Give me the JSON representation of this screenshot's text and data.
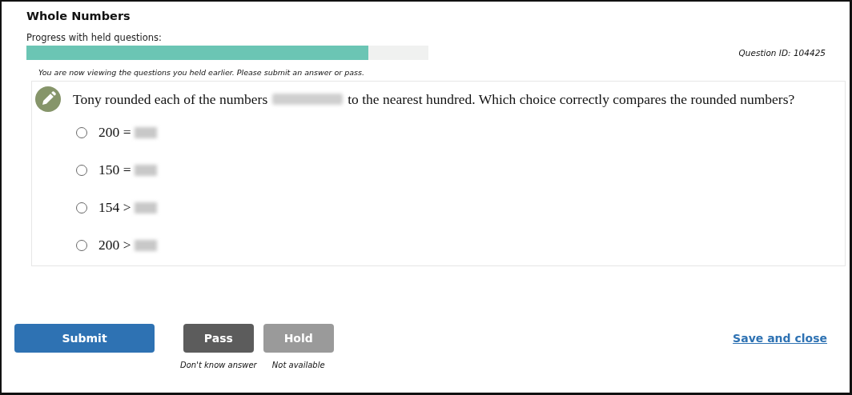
{
  "title": "Whole Numbers",
  "progress": {
    "label": "Progress with held questions:",
    "level": 0.85
  },
  "question_id": "Question ID: 104425",
  "notice": "You are now viewing the questions you held earlier. Please submit an answer or pass.",
  "question": {
    "text_before": "Tony rounded each of the numbers",
    "text_after": "to the nearest hundred. Which choice correctly compares the rounded numbers?",
    "choices": [
      {
        "label": "200 =",
        "selected": false
      },
      {
        "label": "150 =",
        "selected": false
      },
      {
        "label": "154 >",
        "selected": false
      },
      {
        "label": "200 >",
        "selected": false
      }
    ]
  },
  "buttons": [
    {
      "label": "Submit",
      "kind": "primary",
      "disabled": false
    },
    {
      "label": "Pass",
      "kind": "secondary",
      "disabled": false,
      "caption": "Don't know answer"
    },
    {
      "label": "Hold",
      "kind": "secondary",
      "disabled": true,
      "caption": "Not available"
    }
  ],
  "save_link": "Save and close"
}
